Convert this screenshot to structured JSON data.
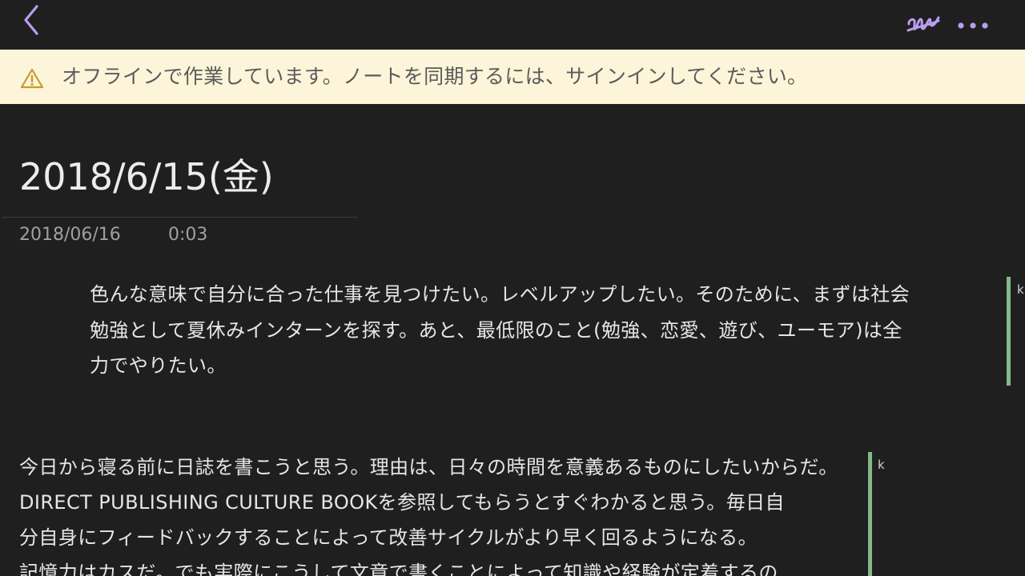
{
  "topbar": {
    "back_icon": "chevron-left-icon",
    "pen_icon": "handwriting-pen-icon",
    "more_icon": "more-dots-icon",
    "accent_color": "#b89ef0"
  },
  "banner": {
    "icon": "warning-icon",
    "message": "オフラインで作業しています。ノートを同期するには、サインインしてください。",
    "background": "#fcf5d9"
  },
  "note": {
    "title": "2018/6/15(金)",
    "date": "2018/06/16",
    "time": "0:03",
    "paragraphs": [
      {
        "author": "k",
        "lines": [
          "色んな意味で自分に合った仕事を見つけたい。レベルアップしたい。そのために、まずは社会",
          "勉強として夏休みインターンを探す。あと、最低限のこと(勉強、恋愛、遊び、ユーモア)は全",
          "力でやりたい。"
        ]
      },
      {
        "author": "k",
        "lines": [
          "今日から寝る前に日誌を書こうと思う。理由は、日々の時間を意義あるものにしたいからだ。",
          "DIRECT PUBLISHING CULTURE BOOKを参照してもらうとすぐわかると思う。毎日自",
          "分自身にフィードバックすることによって改善サイクルがより早く回るようになる。",
          "記憶力はカスだ。でも実際にこうして文章で書くことによって知識や経験が定着するの"
        ]
      }
    ],
    "author_bar_color": "#84b98a"
  }
}
